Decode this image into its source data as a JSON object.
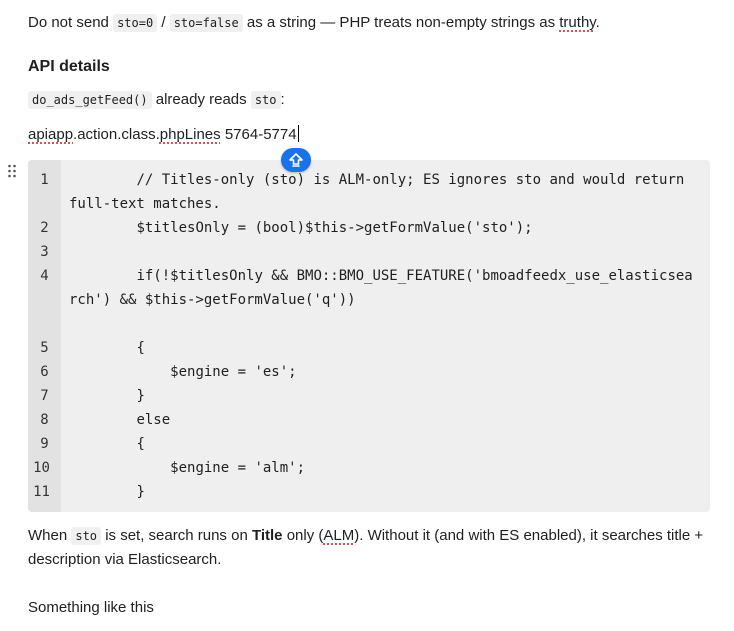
{
  "intro": {
    "prefix": "Do not send ",
    "code1": "sto=0",
    "sep": " / ",
    "code2": "sto=false",
    "mid": " as a string — PHP treats non-empty strings as ",
    "truthy": "truthy",
    "end": "."
  },
  "api_heading": "API details",
  "reads_line": {
    "code1": "do_ads_getFeed()",
    "mid": " already reads ",
    "code2": "sto",
    "end": ":"
  },
  "file_ref": {
    "name_a": "apiapp",
    "name_b": ".action.class.",
    "name_c": "phpLines",
    "lines": " 5764-5774"
  },
  "code": {
    "lines": [
      {
        "num": "1",
        "text": "        // Titles-only (sto) is ALM-only; ES ignores sto and would return full-text matches."
      },
      {
        "num": "2",
        "text": "        $titlesOnly = (bool)$this->getFormValue('sto');"
      },
      {
        "num": "3",
        "text": ""
      },
      {
        "num": "4",
        "text": "        if(!$titlesOnly && BMO::BMO_USE_FEATURE('bmoadfeedx_use_elasticsearch') && $this->getFormValue('q'))"
      },
      {
        "num": "5",
        "text": "        {"
      },
      {
        "num": "6",
        "text": "            $engine = 'es';"
      },
      {
        "num": "7",
        "text": "        }"
      },
      {
        "num": "8",
        "text": "        else"
      },
      {
        "num": "9",
        "text": "        {"
      },
      {
        "num": "10",
        "text": "            $engine = 'alm';"
      },
      {
        "num": "11",
        "text": "        }"
      }
    ]
  },
  "explain": {
    "pre": "When ",
    "code": "sto",
    "mid": " is set, search runs on ",
    "bold": "Title",
    "mid2": " only (",
    "alm": "ALM",
    "post": "). Without it (and with ES enabled), it searches title +",
    "line2": "description via Elasticsearch."
  },
  "closing": "Something like this",
  "icons": {
    "drag": "drag-handle-icon",
    "fab": "upload-arrow-icon"
  },
  "colors": {
    "fab": "#1a73e8",
    "code_bg": "#efefef",
    "gutter_bg": "#e2e2e3",
    "spellcheck": "#d9534f"
  }
}
